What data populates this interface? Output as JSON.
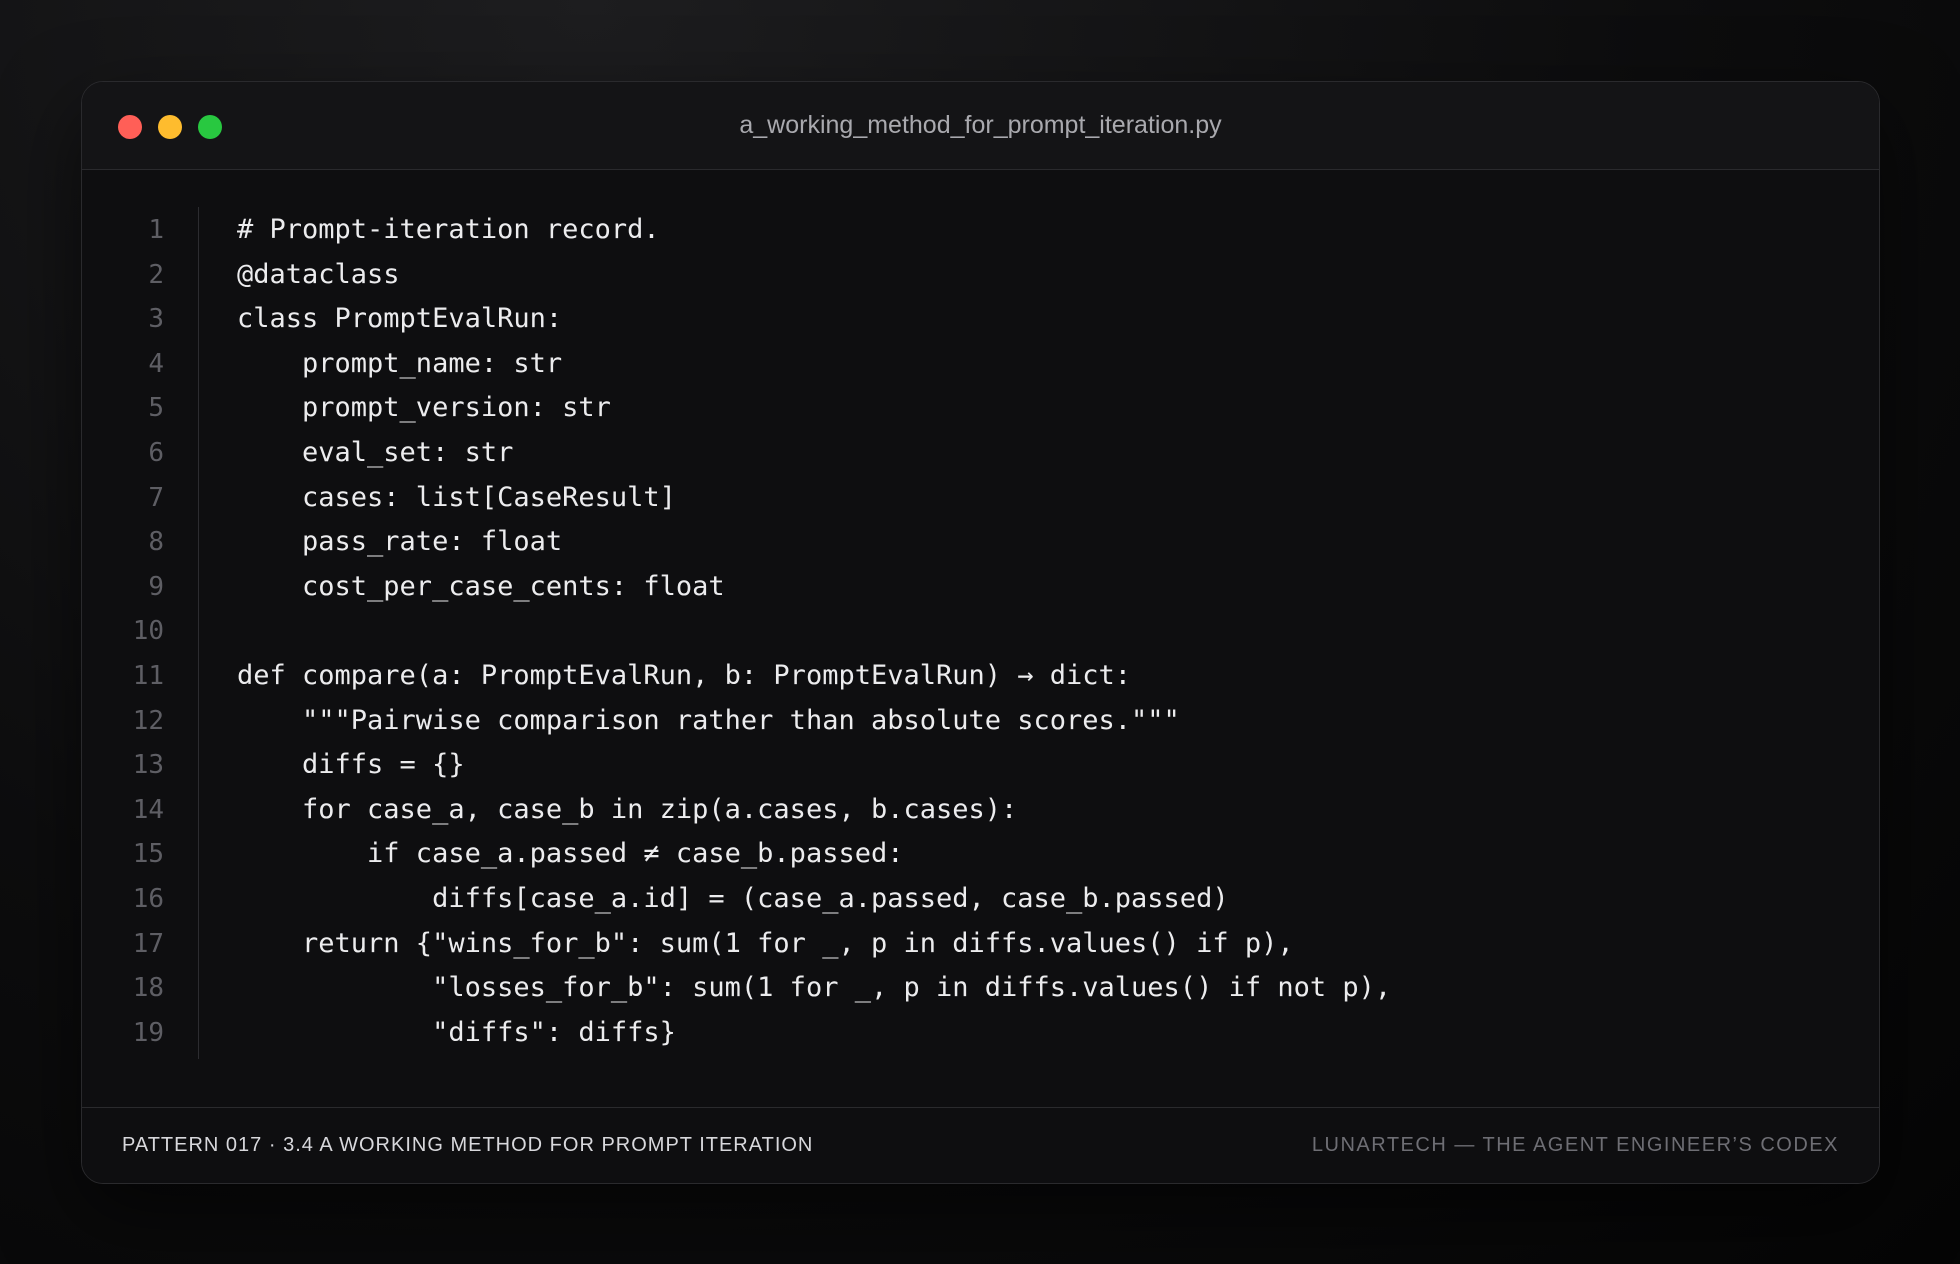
{
  "window": {
    "title": "a_working_method_for_prompt_iteration.py",
    "traffic_lights": {
      "close_color": "#ff5f57",
      "minimize_color": "#febc2e",
      "zoom_color": "#28c840"
    }
  },
  "code": {
    "language": "python",
    "lines": [
      {
        "number": "1",
        "text": "# Prompt-iteration record."
      },
      {
        "number": "2",
        "text": "@dataclass"
      },
      {
        "number": "3",
        "text": "class PromptEvalRun:"
      },
      {
        "number": "4",
        "text": "    prompt_name: str"
      },
      {
        "number": "5",
        "text": "    prompt_version: str"
      },
      {
        "number": "6",
        "text": "    eval_set: str"
      },
      {
        "number": "7",
        "text": "    cases: list[CaseResult]"
      },
      {
        "number": "8",
        "text": "    pass_rate: float"
      },
      {
        "number": "9",
        "text": "    cost_per_case_cents: float"
      },
      {
        "number": "10",
        "text": ""
      },
      {
        "number": "11",
        "text": "def compare(a: PromptEvalRun, b: PromptEvalRun) → dict:"
      },
      {
        "number": "12",
        "text": "    \"\"\"Pairwise comparison rather than absolute scores.\"\"\""
      },
      {
        "number": "13",
        "text": "    diffs = {}"
      },
      {
        "number": "14",
        "text": "    for case_a, case_b in zip(a.cases, b.cases):"
      },
      {
        "number": "15",
        "text": "        if case_a.passed ≠ case_b.passed:"
      },
      {
        "number": "16",
        "text": "            diffs[case_a.id] = (case_a.passed, case_b.passed)"
      },
      {
        "number": "17",
        "text": "    return {\"wins_for_b\": sum(1 for _, p in diffs.values() if p),"
      },
      {
        "number": "18",
        "text": "            \"losses_for_b\": sum(1 for _, p in diffs.values() if not p),"
      },
      {
        "number": "19",
        "text": "            \"diffs\": diffs}"
      }
    ]
  },
  "footer": {
    "left": "PATTERN 017 · 3.4 A WORKING METHOD FOR PROMPT ITERATION",
    "right": "LUNARTECH — THE AGENT ENGINEER’S CODEX"
  }
}
